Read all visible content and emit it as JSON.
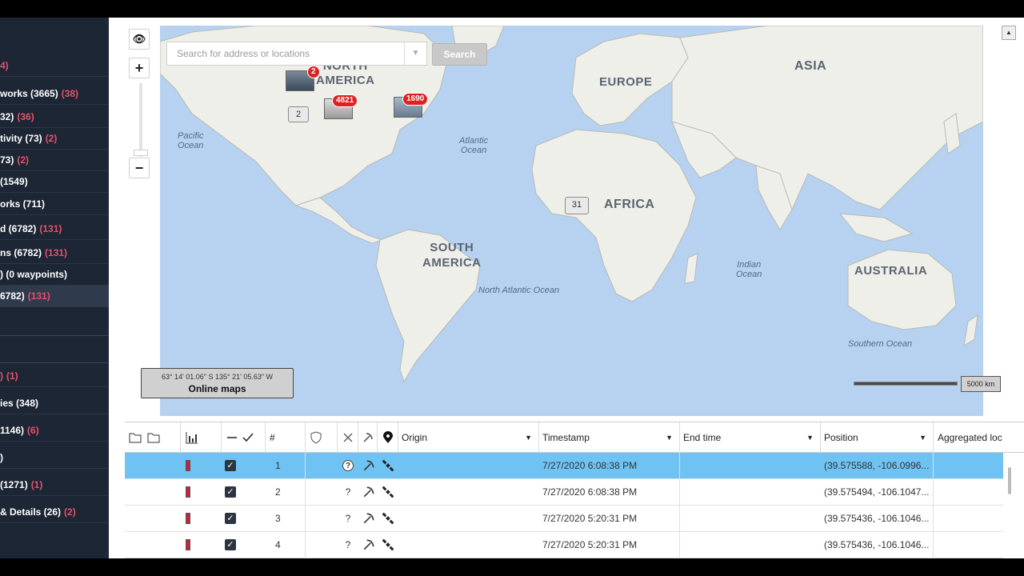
{
  "sidebar": {
    "items": [
      {
        "label": "4)",
        "count": ""
      },
      {
        "label": "works (3665)",
        "count": "(38)"
      },
      {
        "label": "32)",
        "count": "(36)"
      },
      {
        "label": "tivity (73)",
        "count": "(2)"
      },
      {
        "label": "73)",
        "count": "(2)"
      },
      {
        "label": "(1549)",
        "count": ""
      },
      {
        "label": "orks (711)",
        "count": ""
      },
      {
        "label": "d (6782)",
        "count": "(131)"
      },
      {
        "label": "ns (6782)",
        "count": "(131)"
      },
      {
        "label": ")  (0 waypoints)",
        "count": ""
      },
      {
        "label": "6782)",
        "count": "(131)"
      },
      {
        "label": ")",
        "count": "(1)"
      },
      {
        "label": "ies (348)",
        "count": ""
      },
      {
        "label": "1146)",
        "count": "(6)"
      },
      {
        "label": ")",
        "count": ""
      },
      {
        "label": "(1271)",
        "count": "(1)"
      },
      {
        "label": "& Details (26)",
        "count": "(2)"
      }
    ]
  },
  "map": {
    "search_placeholder": "Search for address or locations",
    "search_button": "Search",
    "zoom_in": "+",
    "zoom_out": "−",
    "coordinates": "63° 14' 01.06\" S 135° 21' 05.63\" W",
    "online_maps": "Online maps",
    "scale": "5000 km",
    "labels": {
      "north_america": "NORTH\nAMERICA",
      "europe": "EUROPE",
      "asia": "ASIA",
      "africa": "AFRICA",
      "south_america": "SOUTH\nAMERICA",
      "australia": "AUSTRALIA"
    },
    "oceans": {
      "pacific": "Pacific\nOcean",
      "atlantic": "Atlantic\nOcean",
      "north_atlantic": "North Atlantic Ocean",
      "indian": "Indian\nOcean",
      "southern": "Southern Ocean"
    },
    "clusters": {
      "c1": "2",
      "c2": "2",
      "c3": "4821",
      "c4": "1690",
      "c5": "31"
    }
  },
  "table": {
    "headers": {
      "num": "#",
      "origin": "Origin",
      "timestamp": "Timestamp",
      "end_time": "End time",
      "position": "Position",
      "aggregated": "Aggregated loc"
    },
    "rows": [
      {
        "num": "1",
        "timestamp": "7/27/2020 6:08:38 PM",
        "position": "(39.575588, -106.0996..."
      },
      {
        "num": "2",
        "timestamp": "7/27/2020 6:08:38 PM",
        "position": "(39.575494, -106.1047..."
      },
      {
        "num": "3",
        "timestamp": "7/27/2020 5:20:31 PM",
        "position": "(39.575436, -106.1046..."
      },
      {
        "num": "4",
        "timestamp": "7/27/2020 5:20:31 PM",
        "position": "(39.575436, -106.1046..."
      }
    ]
  },
  "colors": {
    "sidebar_bg": "#1c2634",
    "count_red": "#e8506a",
    "selected_row": "#6fc3f2",
    "ocean": "#b6d2f0",
    "land": "#efefea"
  }
}
